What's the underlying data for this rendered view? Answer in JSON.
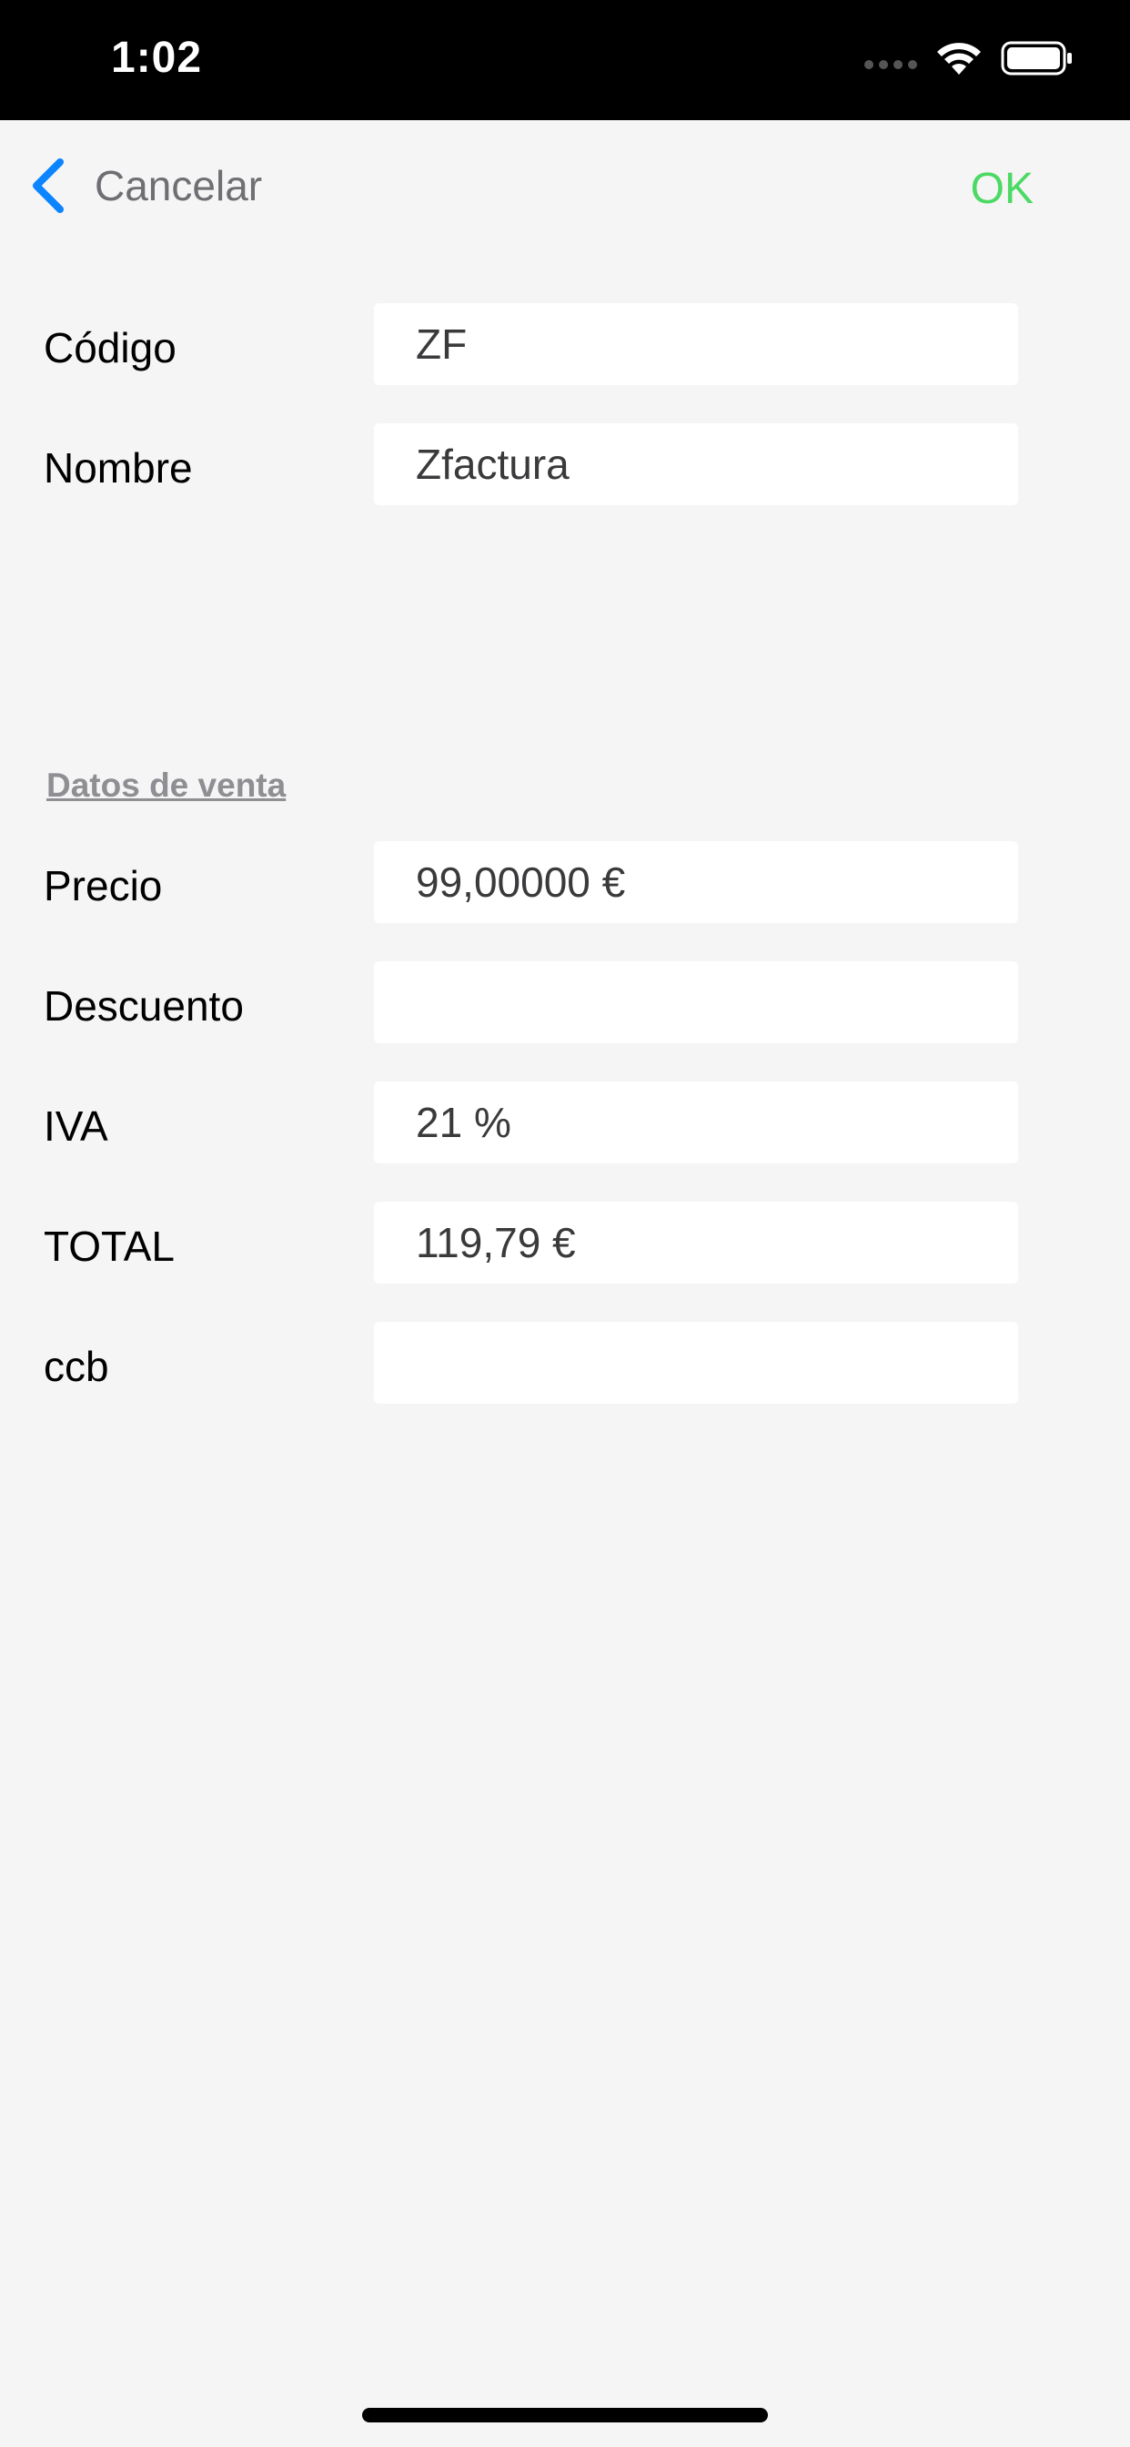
{
  "status_bar": {
    "time": "1:02"
  },
  "nav": {
    "cancel_label": "Cancelar",
    "ok_label": "OK",
    "back_icon": "chevron-left-icon",
    "accent_color": "#0a84ff",
    "ok_color": "#4cd964"
  },
  "fields_top": [
    {
      "label": "Código",
      "value": "ZF"
    },
    {
      "label": "Nombre",
      "value": "Zfactura"
    }
  ],
  "section": {
    "title": "Datos de venta"
  },
  "fields_sale": [
    {
      "label": "Precio",
      "value": "99,00000 €"
    },
    {
      "label": "Descuento",
      "value": ""
    },
    {
      "label": "IVA",
      "value": "21 %"
    },
    {
      "label": "TOTAL",
      "value": "119,79 €"
    },
    {
      "label": "ccb",
      "value": ""
    }
  ]
}
